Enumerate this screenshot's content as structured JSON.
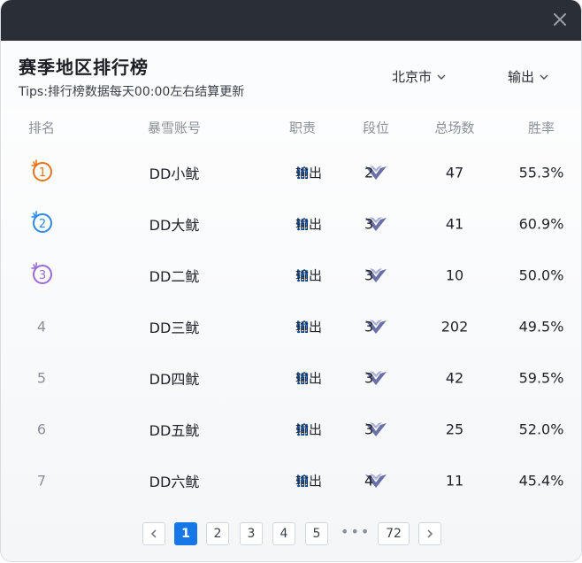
{
  "header": {
    "title": "赛季地区排行榜",
    "tips": "Tips:排行榜数据每天00:00左右结算更新",
    "region_filter": "北京市",
    "role_filter": "输出"
  },
  "table": {
    "columns": [
      "排名",
      "暴雪账号",
      "职责",
      "段位",
      "总场数",
      "胜率"
    ],
    "rows": [
      {
        "rank": "1",
        "account": "DD小鱿",
        "role": "输出",
        "tier": "2",
        "games": "47",
        "winrate": "55.3%"
      },
      {
        "rank": "2",
        "account": "DD大鱿",
        "role": "输出",
        "tier": "3",
        "games": "41",
        "winrate": "60.9%"
      },
      {
        "rank": "3",
        "account": "DD二鱿",
        "role": "输出",
        "tier": "3",
        "games": "10",
        "winrate": "50.0%"
      },
      {
        "rank": "4",
        "account": "DD三鱿",
        "role": "输出",
        "tier": "3",
        "games": "202",
        "winrate": "49.5%"
      },
      {
        "rank": "5",
        "account": "DD四鱿",
        "role": "输出",
        "tier": "3",
        "games": "42",
        "winrate": "59.5%"
      },
      {
        "rank": "6",
        "account": "DD五鱿",
        "role": "输出",
        "tier": "3",
        "games": "25",
        "winrate": "52.0%"
      },
      {
        "rank": "7",
        "account": "DD六鱿",
        "role": "输出",
        "tier": "4",
        "games": "11",
        "winrate": "45.4%"
      }
    ]
  },
  "pagination": {
    "pages": [
      "1",
      "2",
      "3",
      "4",
      "5"
    ],
    "ellipsis": "•••",
    "last": "72",
    "current": "1"
  },
  "colors": {
    "titlebar": "#2a2e35",
    "accent": "#1677e6",
    "rank1": "#e8711a",
    "rank2": "#2e8ae6",
    "rank3": "#9a6ad6",
    "role_icon": "#1a6fe0",
    "tier_icon": "#6a6fa8"
  },
  "icons": {
    "close": "close-icon",
    "dropdown": "chevron-down-icon",
    "role": "damage-role-icon",
    "tier": "tier-emblem-icon",
    "prev": "chevron-left-icon",
    "next": "chevron-right-icon"
  }
}
